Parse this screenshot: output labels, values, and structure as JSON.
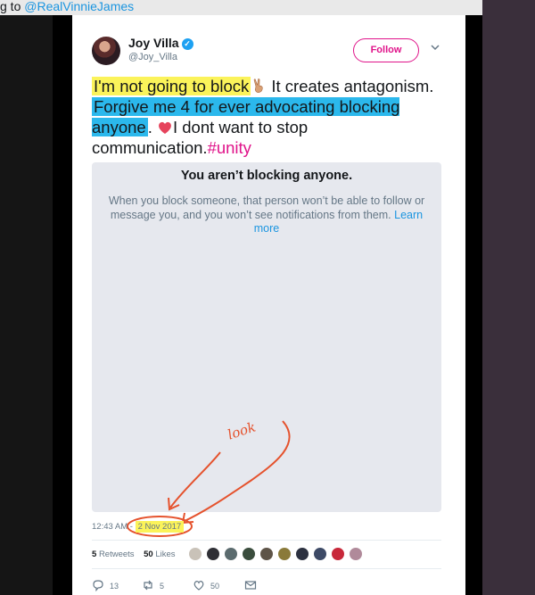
{
  "reply_strip": {
    "prefix": "g to ",
    "mention": "@RealVinnieJames"
  },
  "tweet": {
    "author": {
      "name": "Joy Villa",
      "handle": "@Joy_Villa",
      "verified": true
    },
    "follow_label": "Follow",
    "text": {
      "part1_highlighted": "I'm not going to block",
      "part2": " It creates antagonism. ",
      "part3_highlighted": "Forgive me 4 for ever advocating blocking anyone",
      "part4": ". ",
      "part5": "I dont want to stop communication.",
      "hashtag": "#unity"
    },
    "embed": {
      "title": "You aren’t blocking anyone.",
      "body": "When you block someone, that person won’t be able to follow or message you, and you won’t see notifications from them. ",
      "link": "Learn more"
    },
    "annotation": "look",
    "time": "12:43 AM",
    "separator": " - ",
    "date": "2 Nov 2017",
    "retweets_count": "5",
    "retweets_label": "Retweets",
    "likes_count": "50",
    "likes_label": "Likes",
    "actions": {
      "reply_count": "13",
      "retweet_count": "5",
      "like_count": "50"
    }
  },
  "colors": {
    "accent": "#e0148a",
    "link": "#1b95e0",
    "highlight_yellow": "#fbf35a",
    "highlight_blue": "#2bb8ec",
    "annotation": "#e5522d"
  }
}
